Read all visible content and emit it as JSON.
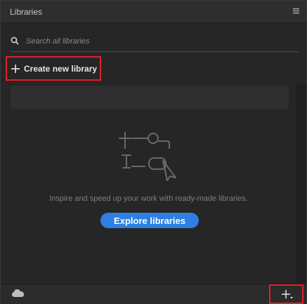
{
  "panel": {
    "title": "Libraries"
  },
  "search": {
    "placeholder": "Search all libraries",
    "value": ""
  },
  "create": {
    "label": "Create new library"
  },
  "empty_state": {
    "message": "Inspire and speed up your work with ready-made libraries.",
    "button_label": "Explore libraries"
  },
  "colors": {
    "accent": "#2d7fe0",
    "highlight_border": "#e0202a",
    "panel_bg": "#262626"
  },
  "icons": {
    "menu": "hamburger-icon",
    "search": "search-icon",
    "create": "plus-icon",
    "illustration": "design-assets-illustration",
    "cloud": "cloud-icon",
    "add": "add-dropdown-icon"
  }
}
